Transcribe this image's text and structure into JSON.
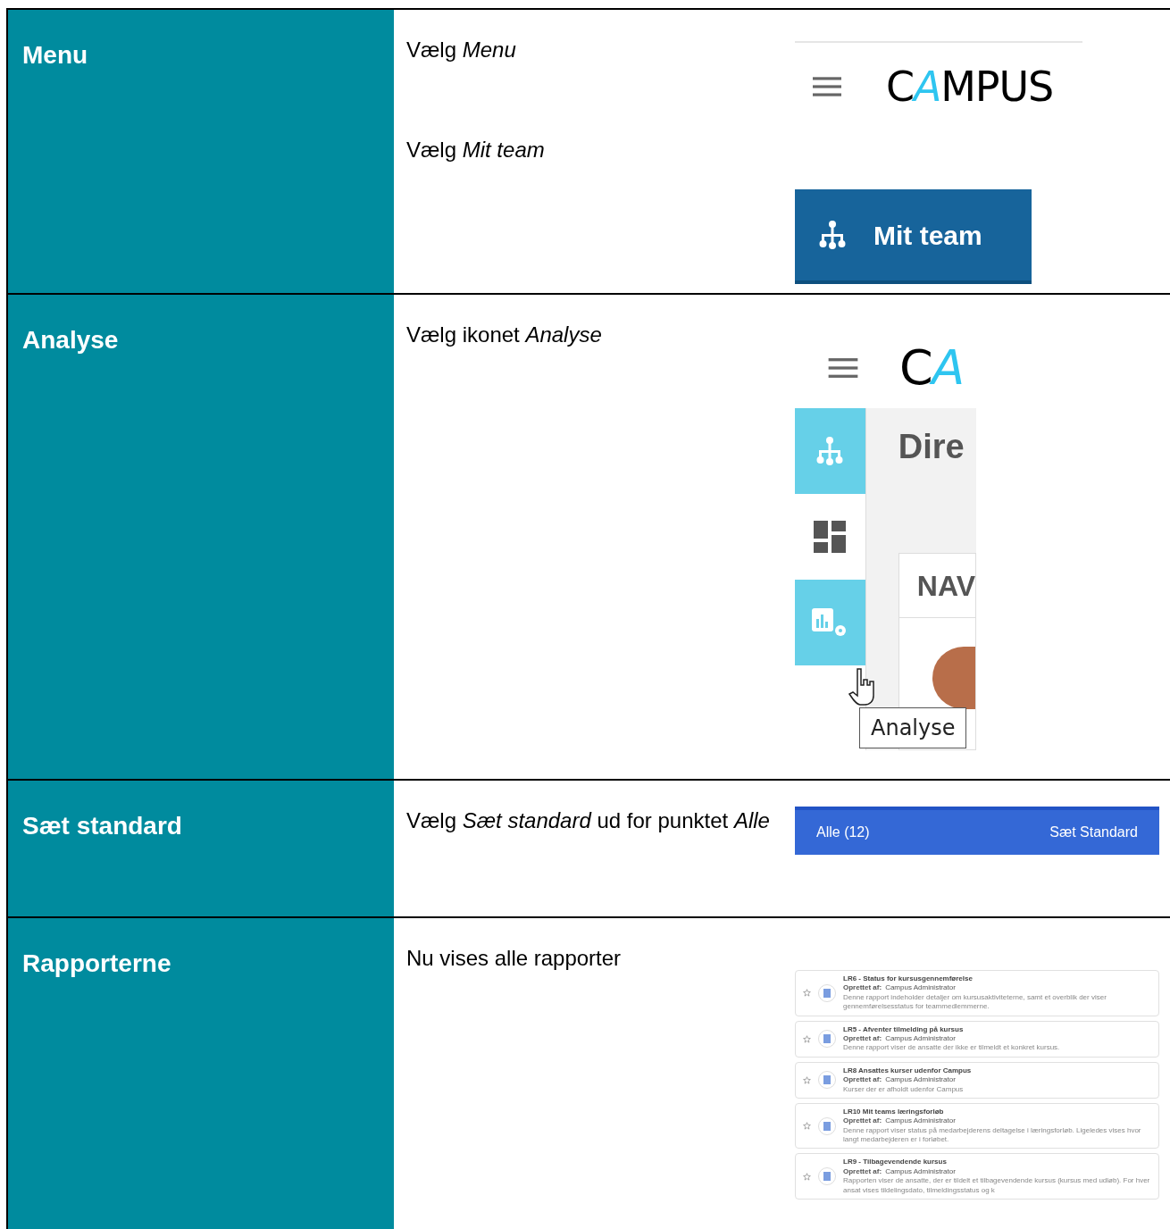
{
  "rows": [
    {
      "label": "Menu",
      "instructions": [
        "Vælg *Menu*",
        "Vælg *Mit team*"
      ],
      "shot": {
        "kind": "menu",
        "logo": [
          {
            "text": "C",
            "accent": false
          },
          {
            "text": "A",
            "accent": true
          },
          {
            "text": "MPUS",
            "accent": false
          }
        ],
        "button": "Mit team"
      }
    },
    {
      "label": "Analyse",
      "instructions": [
        "Vælg ikonet *Analyse*"
      ],
      "shot": {
        "kind": "analyse",
        "logo": [
          {
            "text": "C",
            "accent": false
          },
          {
            "text": "A",
            "accent": true
          }
        ],
        "sidebar": [
          {
            "kind": "org",
            "selected": true
          },
          {
            "kind": "dashboard",
            "selected": false
          },
          {
            "kind": "analytics",
            "selected": true
          }
        ],
        "heading": "Dire",
        "card_header": "NAV",
        "tooltip": "Analyse"
      }
    },
    {
      "label": "Sæt standard",
      "instructions": [
        "Vælg *Sæt standard* ud for punktet *Alle*"
      ],
      "shot": {
        "kind": "bar",
        "item": "Alle (12)",
        "action": "Sæt Standard"
      }
    },
    {
      "label": "Rapporterne",
      "instructions": [
        "Nu vises alle rapporter"
      ],
      "shot": {
        "kind": "reports",
        "reports": [
          {
            "title": "LR6 - Status for kursusgennemførelse",
            "created_label": "Oprettet af:",
            "creator": "Campus Administrator",
            "description": "Denne rapport indeholder detaljer om kursusaktiviteterne, samt et overblik der viser gennemførelsesstatus for teammedlemmerne."
          },
          {
            "title": "LR5 - Afventer tilmelding på kursus",
            "created_label": "Oprettet af:",
            "creator": "Campus Administrator",
            "description": "Denne rapport viser de ansatte der ikke er tilmeldt et konkret kursus."
          },
          {
            "title": "LR8 Ansattes kurser udenfor Campus",
            "created_label": "Oprettet af:",
            "creator": "Campus Administrator",
            "description": "Kurser der er afholdt udenfor Campus"
          },
          {
            "title": "LR10 Mit teams læringsforløb",
            "created_label": "Oprettet af:",
            "creator": "Campus Administrator",
            "description": "Denne rapport viser status på medarbejderens deltagelse i læringsforløb. Ligeledes vises hvor langt medarbejderen er i forløbet."
          },
          {
            "title": "LR9 - Tilbagevendende kursus",
            "created_label": "Oprettet af:",
            "creator": "Campus Administrator",
            "description": "Rapporten viser de ansatte, der er tildelt et tilbagevendende kursus (kursus med udløb). For hver ansat vises tildelingsdato, tilmeldingsstatus og k"
          }
        ]
      }
    }
  ]
}
